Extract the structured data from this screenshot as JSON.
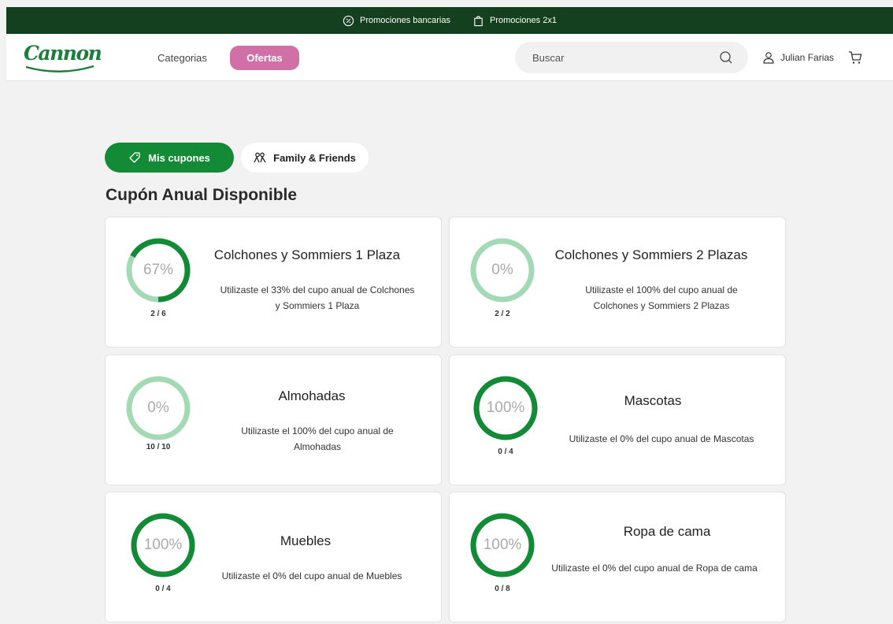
{
  "promo_bar": {
    "items": [
      {
        "label": "Promociones bancarias",
        "icon": "percent-badge-icon"
      },
      {
        "label": "Promociones 2x1",
        "icon": "shopping-bag-icon"
      }
    ]
  },
  "header": {
    "logo": "Cannon",
    "nav": {
      "categorias": "Categorias",
      "ofertas": "Ofertas"
    },
    "search_placeholder": "Buscar",
    "user_name": "Julian Farias"
  },
  "tabs": [
    {
      "label": "Mis cupones",
      "icon": "tag-icon",
      "active": true
    },
    {
      "label": "Family & Friends",
      "icon": "people-icon",
      "active": false
    }
  ],
  "section_title": "Cupón Anual Disponible",
  "colors": {
    "brand_green": "#138a36",
    "ring_light": "#a3d9b4",
    "ofertas_pink": "#d070a6",
    "promo_bar": "#14401f"
  },
  "coupons": [
    {
      "title": "Colchones y Sommiers 1 Plaza",
      "percent": "67%",
      "remaining": 0.67,
      "desc": "Utilizaste el 33% del cupo anual de Colchones y Sommiers 1 Plaza",
      "fraction": "2 / 6"
    },
    {
      "title": "Colchones y Sommiers 2 Plazas",
      "percent": "0%",
      "remaining": 0,
      "desc": "Utilizaste el 100% del cupo anual de Colchones y Sommiers 2 Plazas",
      "fraction": "2 / 2"
    },
    {
      "title": "Almohadas",
      "percent": "0%",
      "remaining": 0,
      "desc": "Utilizaste el 100% del cupo anual de Almohadas",
      "fraction": "10 / 10"
    },
    {
      "title": "Mascotas",
      "percent": "100%",
      "remaining": 1,
      "desc": "Utilizaste el 0% del cupo anual de Mascotas",
      "fraction": "0 / 4"
    },
    {
      "title": "Muebles",
      "percent": "100%",
      "remaining": 1,
      "desc": "Utilizaste el 0% del cupo anual de Muebles",
      "fraction": "0 / 4"
    },
    {
      "title": "Ropa de cama",
      "percent": "100%",
      "remaining": 1,
      "desc": "Utilizaste el 0% del cupo anual de Ropa de cama",
      "fraction": "0 / 8"
    }
  ]
}
